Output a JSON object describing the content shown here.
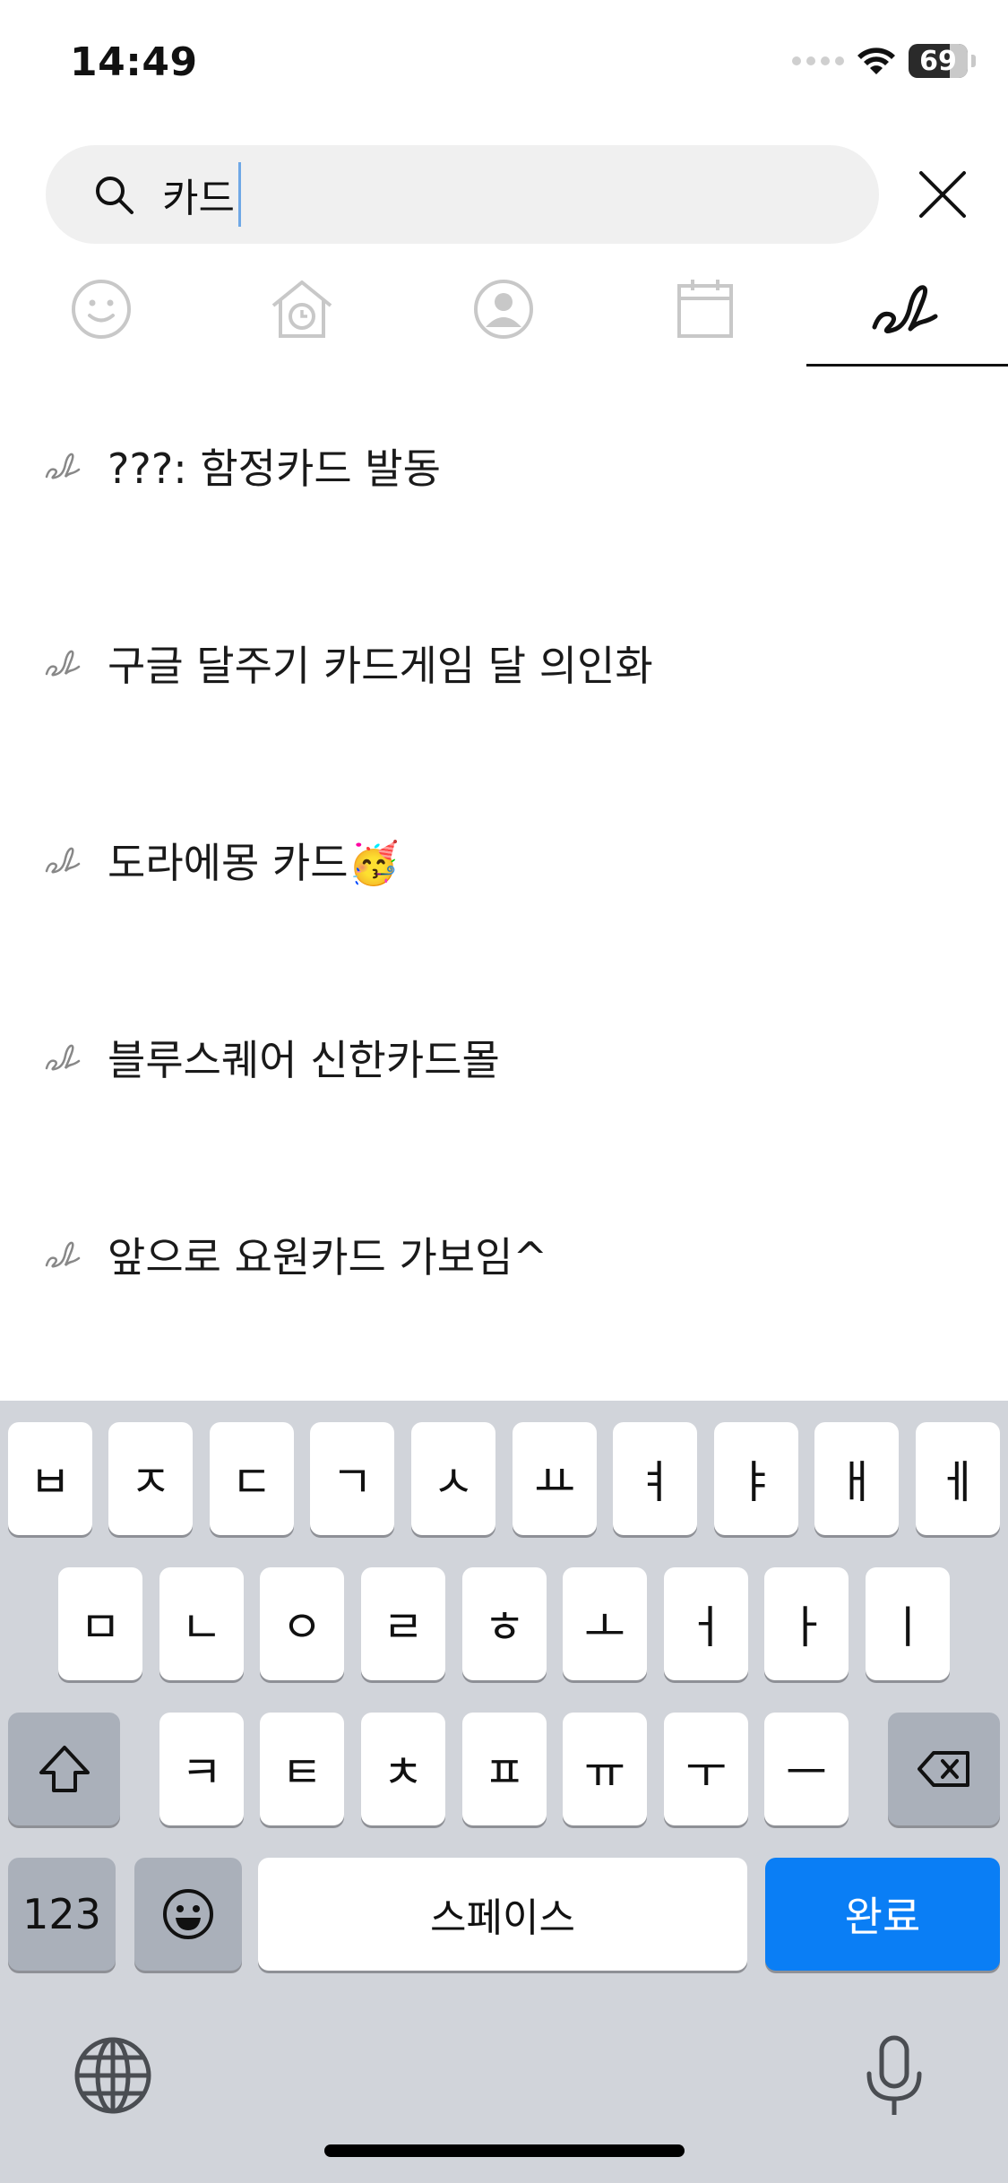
{
  "status_bar": {
    "time": "14:49",
    "battery": "69",
    "battery_level": 0.69
  },
  "search": {
    "query": "카드",
    "search_icon": "search-icon",
    "close_icon": "close-icon"
  },
  "tabs": [
    {
      "icon": "smiley-icon",
      "selected": false
    },
    {
      "icon": "house-clock-icon",
      "selected": false
    },
    {
      "icon": "person-circle-icon",
      "selected": false
    },
    {
      "icon": "calendar-icon",
      "selected": false
    },
    {
      "icon": "handwriting-icon",
      "selected": true
    }
  ],
  "results": [
    {
      "icon": "handwriting-icon",
      "text": "???: 함정카드 발동"
    },
    {
      "icon": "handwriting-icon",
      "text": "구글 달주기 카드게임 달 의인화"
    },
    {
      "icon": "handwriting-icon",
      "text": "도라에몽 카드🥳"
    },
    {
      "icon": "handwriting-icon",
      "text": "블루스퀘어 신한카드몰"
    },
    {
      "icon": "handwriting-icon",
      "text": "앞으로 요원카드 가보임^"
    }
  ],
  "keyboard": {
    "row1": [
      "ㅂ",
      "ㅈ",
      "ㄷ",
      "ㄱ",
      "ㅅ",
      "ㅛ",
      "ㅕ",
      "ㅑ",
      "ㅐ",
      "ㅔ"
    ],
    "row2": [
      "ㅁ",
      "ㄴ",
      "ㅇ",
      "ㄹ",
      "ㅎ",
      "ㅗ",
      "ㅓ",
      "ㅏ",
      "ㅣ"
    ],
    "row3": [
      "ㅋ",
      "ㅌ",
      "ㅊ",
      "ㅍ",
      "ㅠ",
      "ㅜ",
      "ㅡ"
    ],
    "numbers_label": "123",
    "space_label": "스페이스",
    "done_label": "완료",
    "accent_color": "#0a7ef5"
  }
}
